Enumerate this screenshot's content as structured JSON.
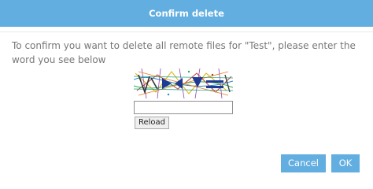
{
  "dialog": {
    "title": "Confirm delete",
    "message": "To confirm you want to delete all remote files for \"Test\", please enter the word you see below",
    "input_value": "",
    "reload_label": "Reload",
    "cancel_label": "Cancel",
    "ok_label": "OK"
  },
  "colors": {
    "accent": "#62aee0",
    "text": "#777777"
  },
  "icons": {
    "captcha": "captcha-image"
  }
}
